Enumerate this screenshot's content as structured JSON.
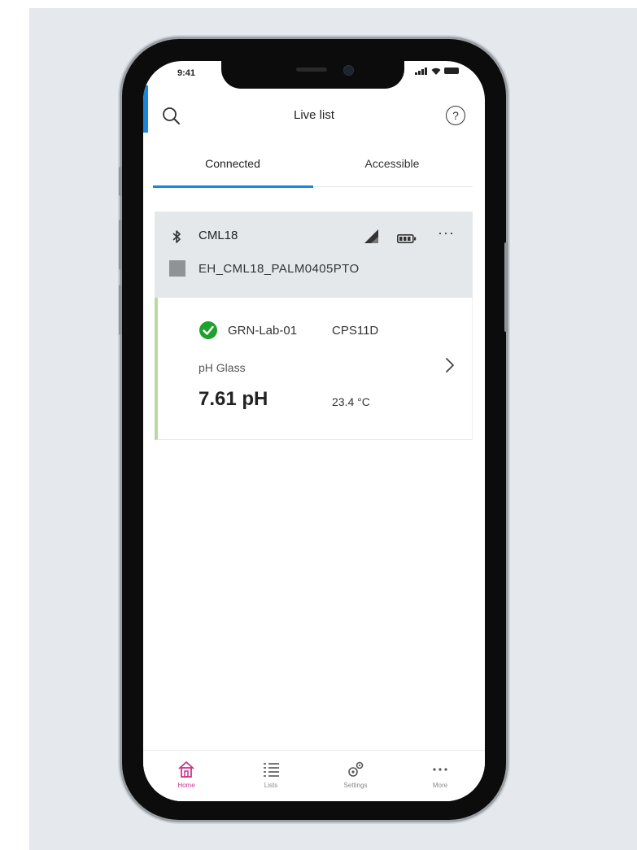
{
  "status_bar": {
    "time": "9:41"
  },
  "appbar": {
    "title": "Live list",
    "search_icon": "search-icon",
    "help_icon": "help-icon",
    "help_glyph": "?"
  },
  "tabs": [
    {
      "label": "Connected",
      "active": true
    },
    {
      "label": "Accessible",
      "active": false
    }
  ],
  "device": {
    "name": "CML18",
    "id": "EH_CML18_PALM0405PTO",
    "icons": [
      "bluetooth-icon",
      "signal-strength-icon",
      "battery-icon",
      "more-icon"
    ],
    "more_glyph": "···"
  },
  "sensor": {
    "tag": "GRN-Lab-01",
    "model": "CPS11D",
    "parameter": "pH Glass",
    "value": "7.61 pH",
    "temperature": "23.4 °C",
    "status": "ok"
  },
  "bottom_nav": [
    {
      "label": "Home",
      "icon": "home-icon",
      "active": true
    },
    {
      "label": "Lists",
      "icon": "list-icon",
      "active": false
    },
    {
      "label": "Settings",
      "icon": "settings-icon",
      "active": false
    },
    {
      "label": "More",
      "icon": "more-icon",
      "active": false
    }
  ],
  "colors": {
    "accent_blue": "#1a86d8",
    "active_pink": "#c8338a",
    "ok_green": "#1fa12e",
    "card_gray": "#e4e8eb",
    "backdrop": "#e5e9ed"
  }
}
